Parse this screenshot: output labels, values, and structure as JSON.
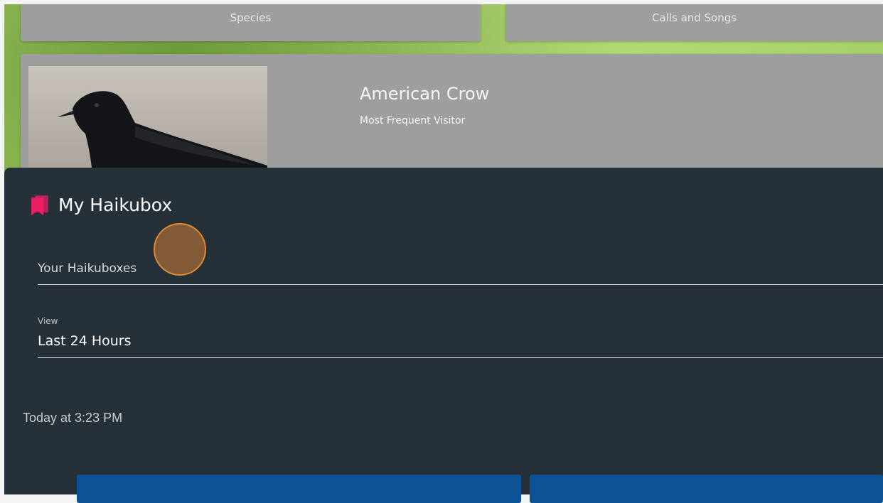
{
  "tiles": {
    "species_label": "Species",
    "calls_label": "Calls and Songs"
  },
  "visitor": {
    "name": "American Crow",
    "subtitle": "Most Frequent Visitor",
    "photo_icon": "crow-photo"
  },
  "panel": {
    "title": "My Haikubox",
    "title_icon": "bookmark-icon",
    "title_icon_color": "#e91e63",
    "haikuboxes_label": "Your Haikuboxes",
    "view_caption": "View",
    "view_value": "Last 24 Hours",
    "timestamp": "Today at 3:23 PM"
  },
  "colors": {
    "panel_bg": "#263038",
    "card_bg": "#9e9e9e",
    "button_bg": "#0b5394",
    "cursor_ring": "#e08a2e"
  }
}
